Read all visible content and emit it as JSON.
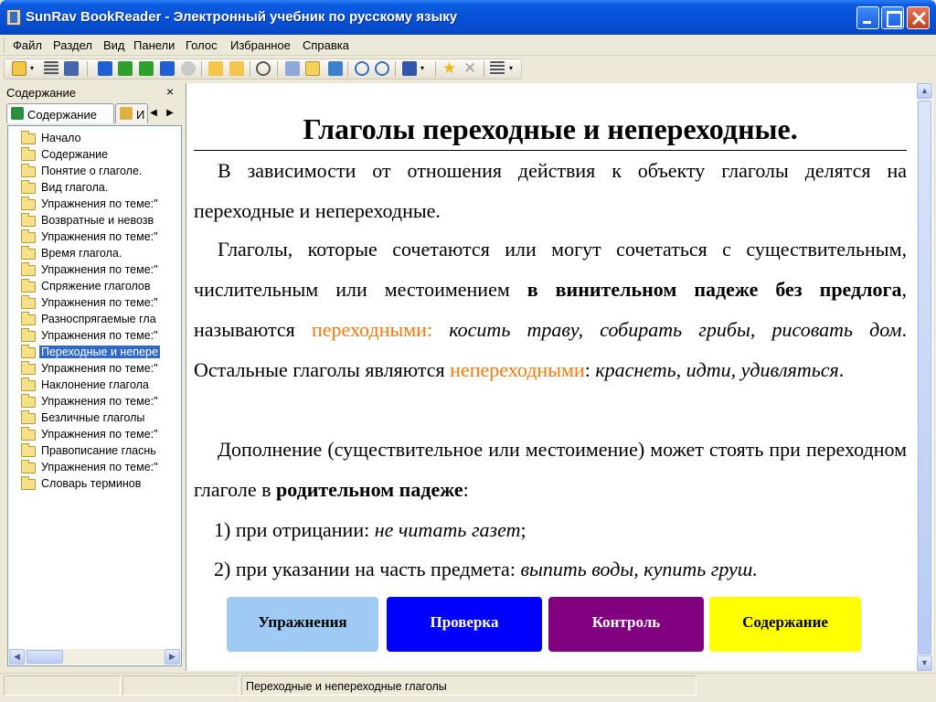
{
  "window": {
    "title": "SunRav BookReader - Электронный учебник по русскому языку"
  },
  "menu": [
    "Файл",
    "Раздел",
    "Вид",
    "Панели",
    "Голос",
    "Избранное",
    "Справка"
  ],
  "sidebar": {
    "title": "Содержание",
    "close": "×",
    "tabs": [
      {
        "label": "Содержание"
      },
      {
        "label": "И"
      }
    ],
    "tree": [
      "Начало",
      "Содержание",
      "Понятие о глаголе.",
      "Вид глагола.",
      "Упражнения по теме:\"",
      "Возвратные и невозв",
      "Упражнения по теме:\"",
      "Время глагола.",
      "Упражнения по теме:\"",
      "Спряжение глаголов",
      "Упражнения по теме:\"",
      "Разноспрягаемые гла",
      "Упражнения по теме:\"",
      "Переходные и непере",
      "Упражнения по теме:\"",
      "Наклонение глагола",
      "Упражнения по теме:\"",
      "Безличные глаголы",
      "Упражнения по теме:\"",
      "Правописание гласнь",
      "Упражнения по теме:\"",
      "Словарь терминов"
    ],
    "selected_index": 13
  },
  "document": {
    "heading": "Глаголы переходные и непереходные.",
    "p1": "В зависимости от отношения действия к объекту глаголы делятся на переходные и непереходные.",
    "p2_a": "Глаголы, которые сочетаются или могут сочетаться с существительным, числительным или местоимением ",
    "p2_b": "в винительном падеже без предлога",
    "p2_c": ", называются ",
    "p2_d": "переходными",
    "p2_e": ": ",
    "p2_f": "косить траву, собирать грибы, рисовать дом",
    "p2_g": ". Остальные глаголы являются ",
    "p2_h": "непереходными",
    "p2_i": ": ",
    "p2_j": "краснеть, идти, удивляться",
    "p2_k": ".",
    "p3_a": "Дополнение (существительное или местоимение) может стоять при переходном глаголе в ",
    "p3_b": "родительном падеже",
    "p3_c": ":",
    "l1_a": "1) при отрицании: ",
    "l1_b": "не читать газет",
    "l1_c": ";",
    "l2_a": "2) при указании на часть предмета: ",
    "l2_b": "выпить воды, купить груш."
  },
  "nav_buttons": {
    "exercises": "Упражнения",
    "check": "Проверка",
    "control": "Контроль",
    "contents": "Содержание"
  },
  "status": {
    "cell3": "Переходные и непереходные глаголы"
  }
}
